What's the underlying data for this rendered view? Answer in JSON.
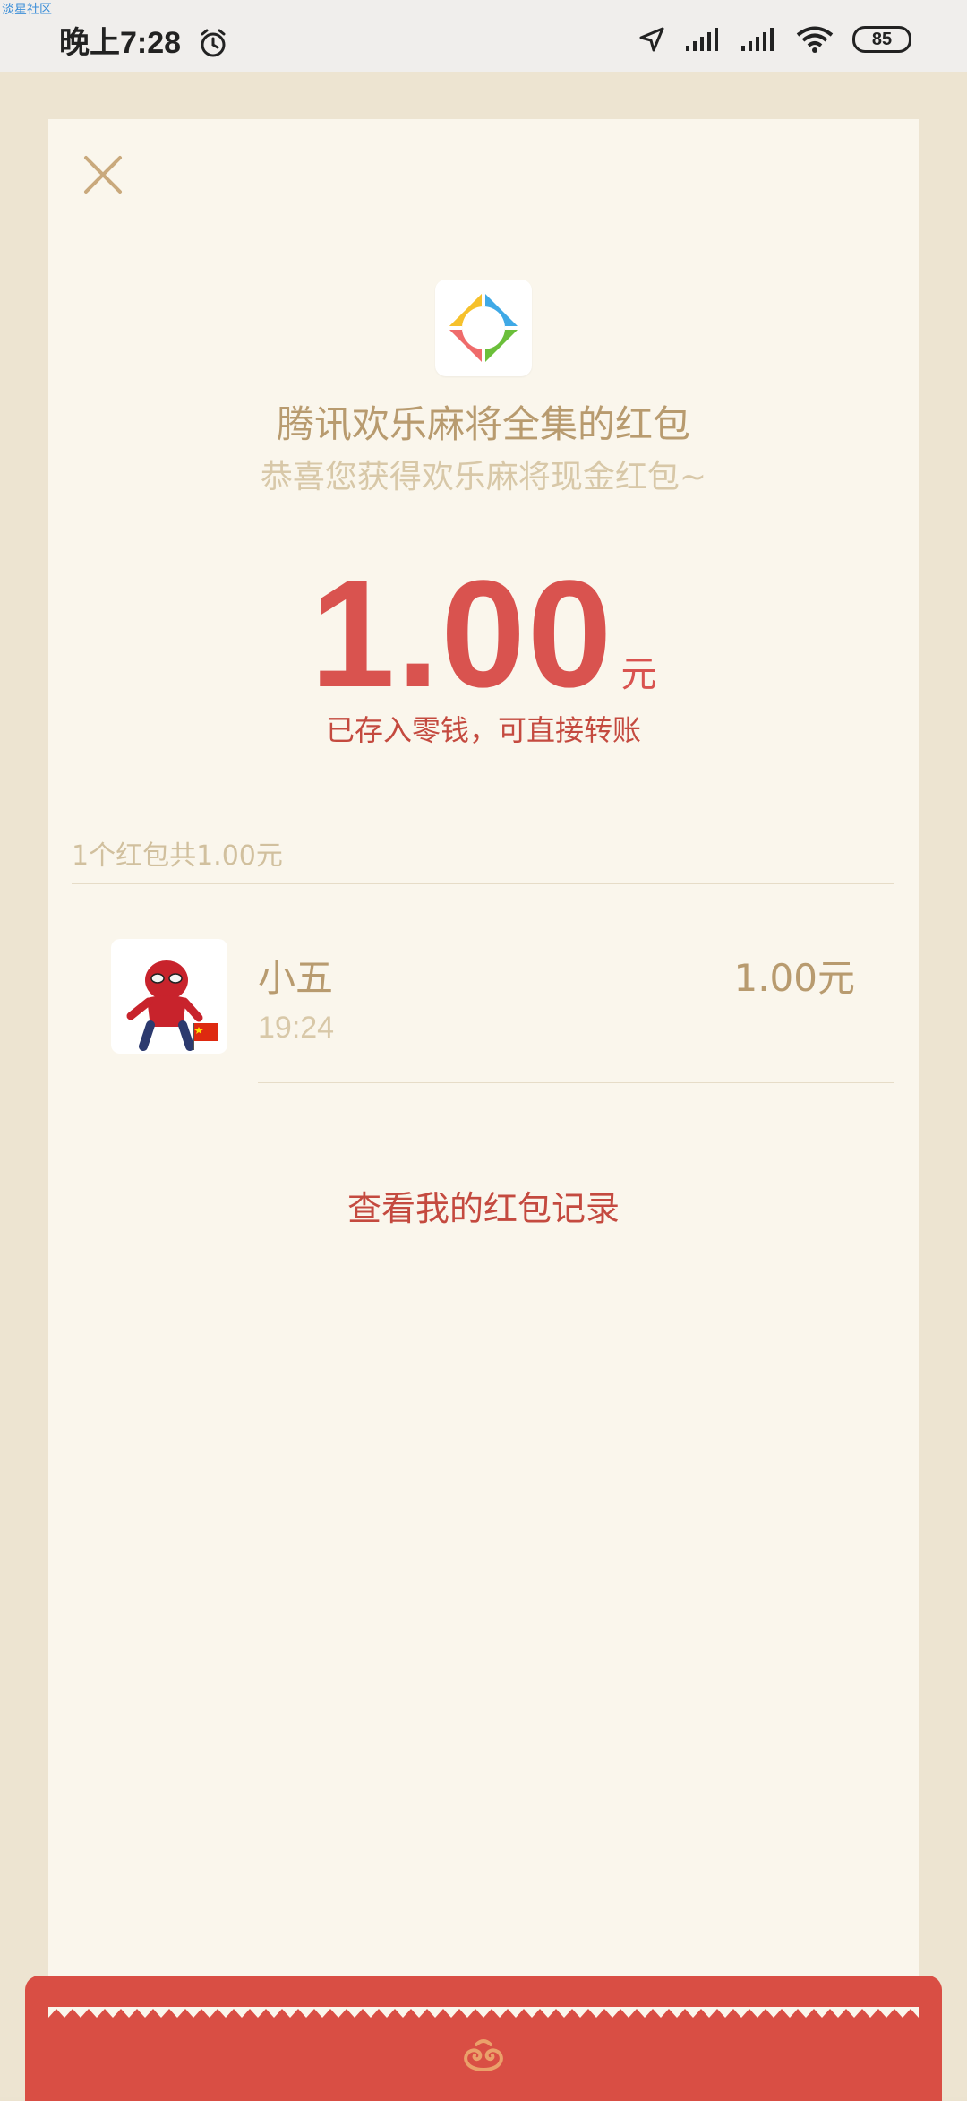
{
  "watermark": "淡星社区",
  "status_bar": {
    "time": "晚上7:28",
    "battery": "85"
  },
  "card": {
    "title": "腾讯欢乐麻将全集的红包",
    "subtitle": "恭喜您获得欢乐麻将现金红包~",
    "amount": "1.00",
    "unit": "元",
    "note": "已存入零钱，可直接转账"
  },
  "summary": "1个红包共1.00元",
  "receipt": {
    "name": "小五",
    "time": "19:24",
    "amount": "1.00元"
  },
  "records_link": "查看我的红包记录",
  "colors": {
    "accent_red": "#d9534f",
    "gold_text": "#b89b6f",
    "card_bg": "#faf6ec"
  }
}
